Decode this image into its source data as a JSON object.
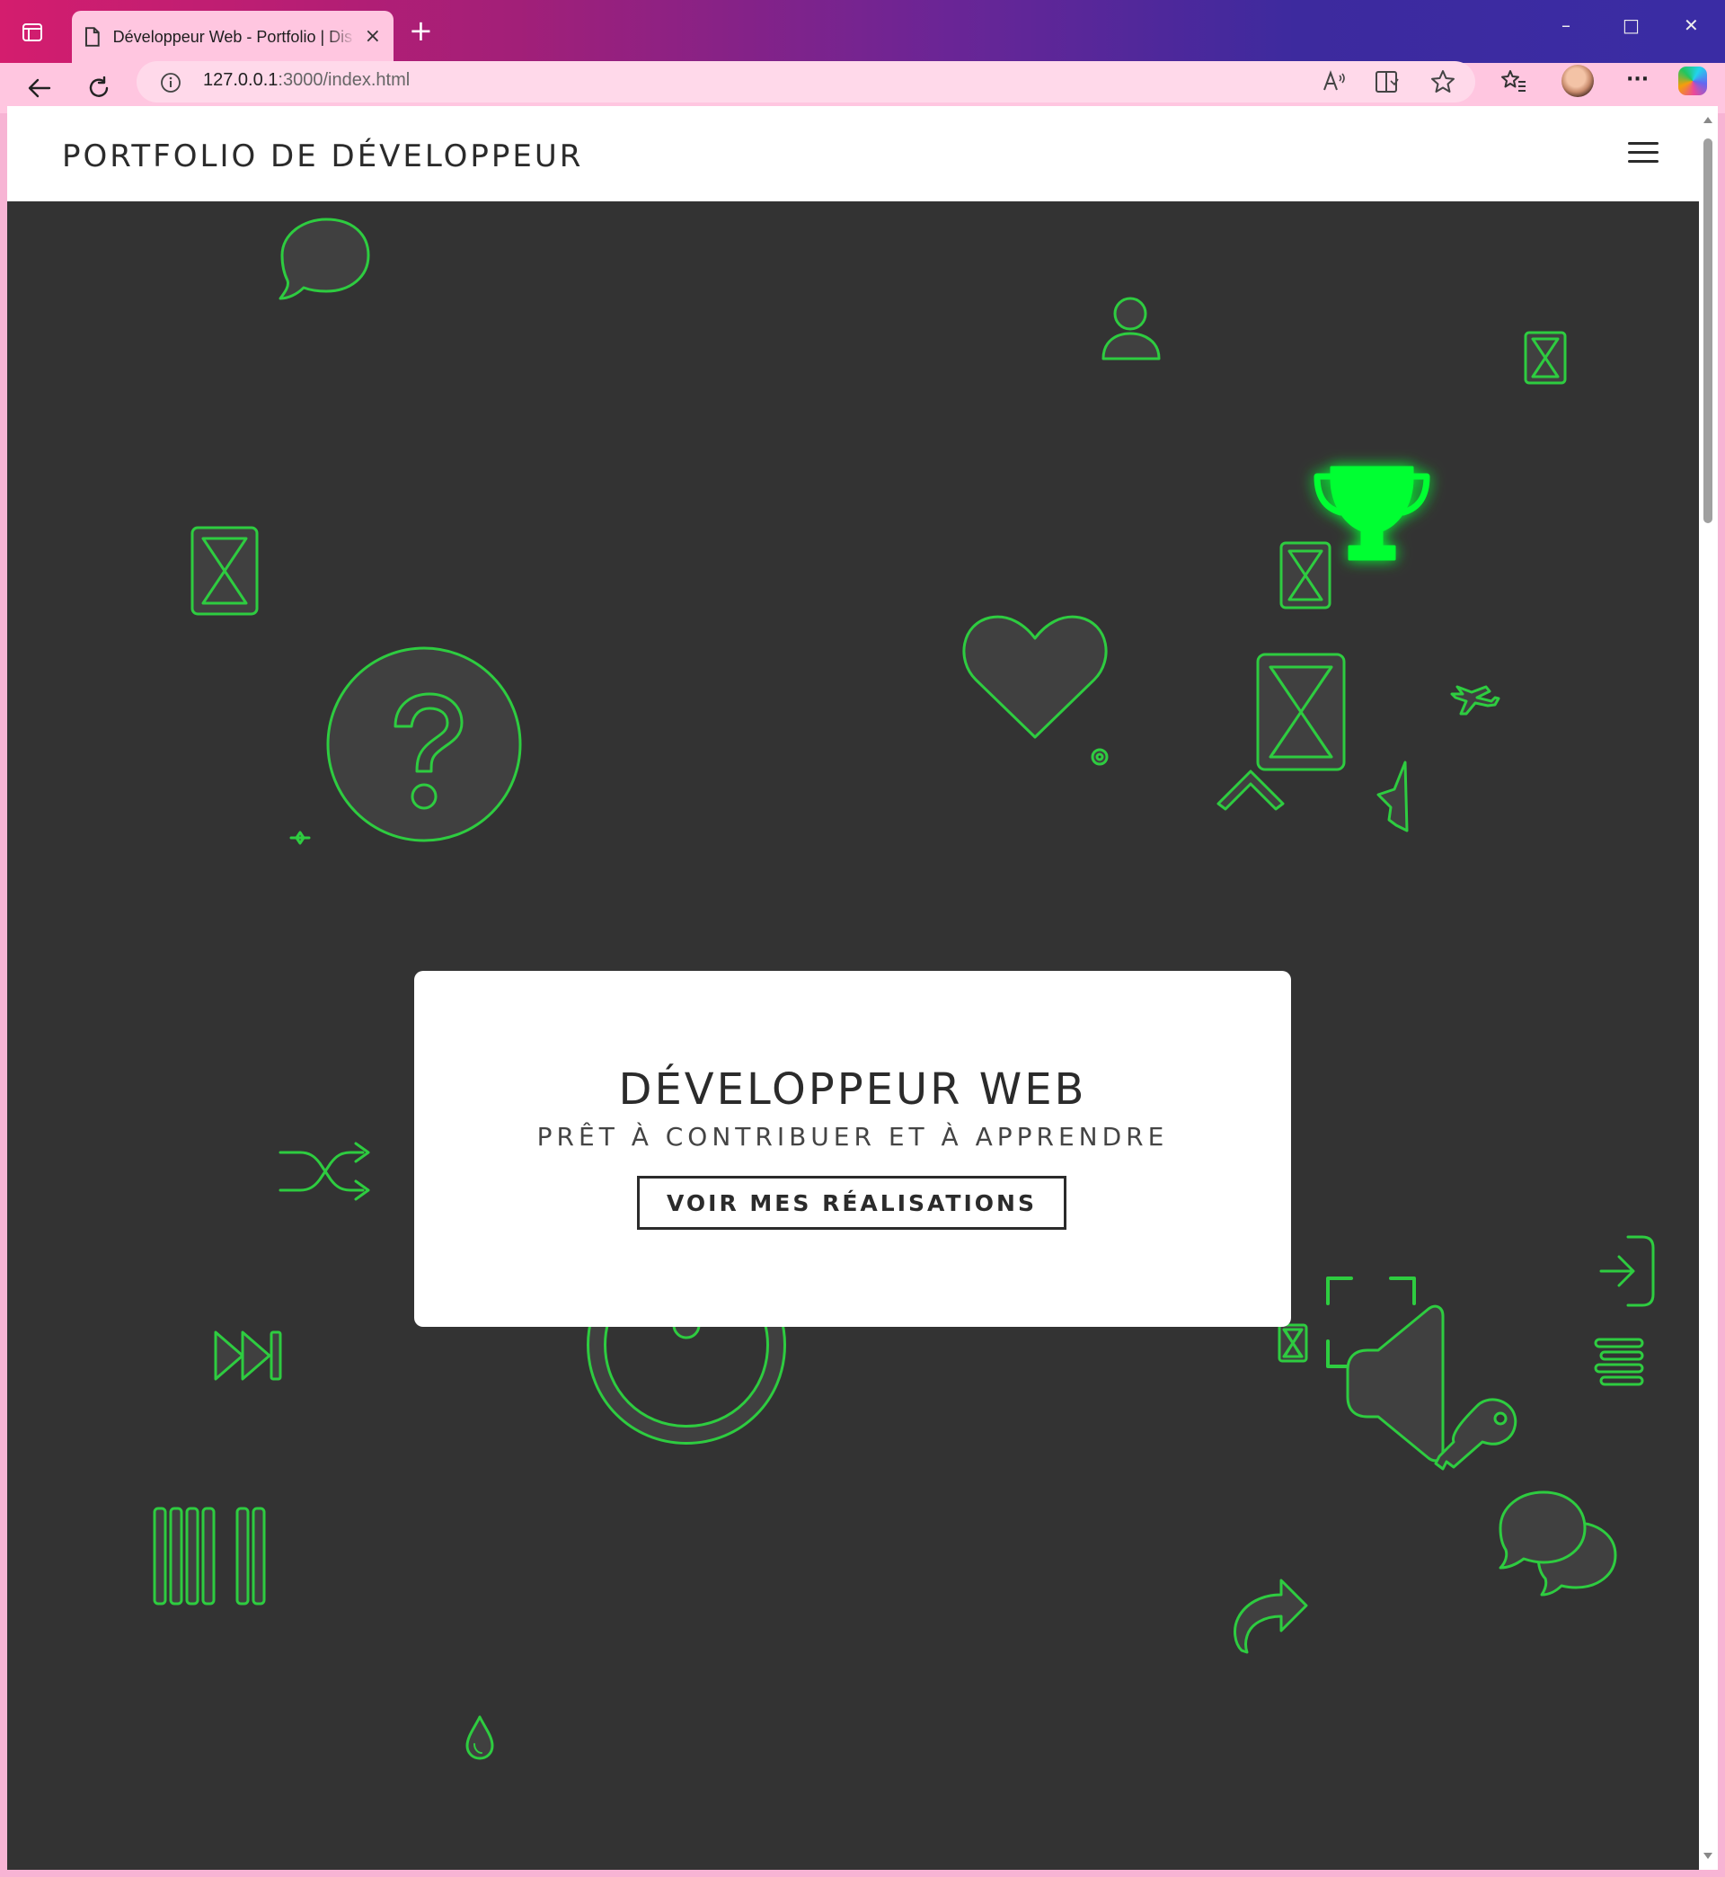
{
  "browser": {
    "tab_title": "Développeur Web - Portfolio | Dis",
    "url_host": "127.0.0.1",
    "url_path": ":3000/index.html",
    "new_tab_symbol": "+",
    "close_tab_symbol": "×",
    "minimize_symbol": "–",
    "maximize_symbol": "□",
    "close_window_symbol": "✕",
    "more_symbol": "···"
  },
  "site": {
    "brand": "PORTFOLIO DE DÉVELOPPEUR",
    "hero": {
      "title": "DÉVELOPPEUR WEB",
      "subtitle": "PRÊT À CONTRIBUER ET À APPRENDRE",
      "cta_label": "VOIR MES RÉALISATIONS"
    }
  },
  "colors": {
    "hero_bg": "#333333",
    "icon_stroke": "#2ecc40",
    "icon_fill": "#404040",
    "glow": "#00ff33"
  },
  "decorative_icons": [
    "speech-bubble-icon",
    "user-icon",
    "hourglass-icon",
    "trophy-icon",
    "heart-icon",
    "question-icon",
    "airplane-icon",
    "gear-icon",
    "chevron-up-icon",
    "star-icon",
    "shuffle-icon",
    "power-icon",
    "fast-forward-icon",
    "barcode-icon",
    "plus-circle-icon",
    "expand-icon",
    "volume-icon",
    "key-icon",
    "sign-in-icon",
    "align-icon",
    "comments-icon",
    "share-icon",
    "droplet-icon",
    "sparkle-icon"
  ]
}
